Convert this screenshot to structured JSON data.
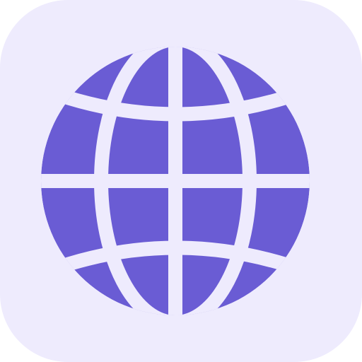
{
  "icon": {
    "name": "globe-icon",
    "background_color": "#EEEBFD",
    "globe_color": "#6A5CD4",
    "line_color": "#EEEBFD"
  }
}
